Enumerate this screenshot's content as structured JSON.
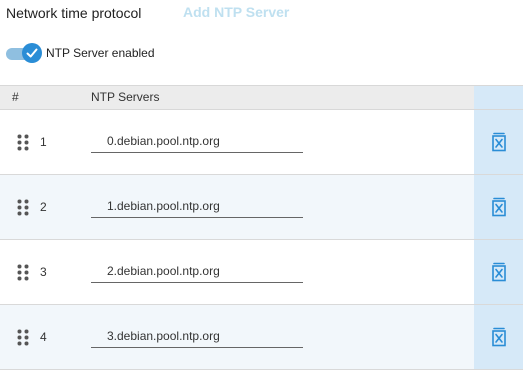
{
  "header": {
    "title": "Network time protocol",
    "add_button_label": "Add NTP Server"
  },
  "toggle": {
    "label": "NTP Server enabled",
    "enabled": true,
    "accent_color": "#2a8dd6"
  },
  "table": {
    "columns": [
      "#",
      "NTP Servers"
    ],
    "rows": [
      {
        "index": "1",
        "server": "0.debian.pool.ntp.org"
      },
      {
        "index": "2",
        "server": "1.debian.pool.ntp.org"
      },
      {
        "index": "3",
        "server": "2.debian.pool.ntp.org"
      },
      {
        "index": "4",
        "server": "3.debian.pool.ntp.org"
      }
    ],
    "row_icons": {
      "drag": "drag-handle-icon",
      "delete": "delete-icon"
    }
  }
}
